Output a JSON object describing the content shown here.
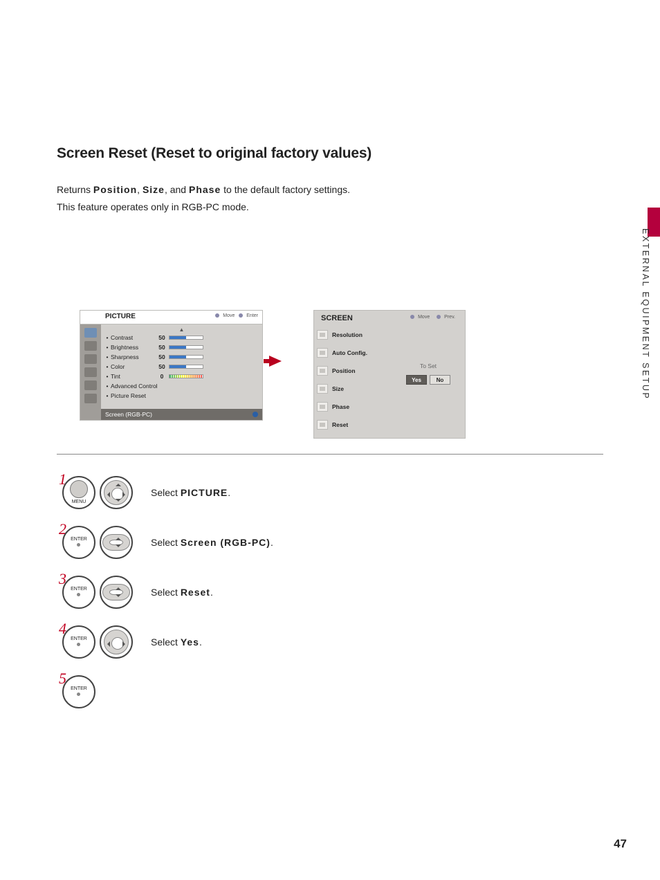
{
  "page": {
    "title": "Screen Reset (Reset to original factory values)",
    "intro_pre": "Returns ",
    "intro_w1": "Position",
    "intro_c1": ", ",
    "intro_w2": "Size",
    "intro_c2": ", and ",
    "intro_w3": "Phase",
    "intro_post": " to the default factory settings.",
    "intro_line2": "This feature operates only in RGB-PC mode.",
    "side_label": "EXTERNAL EQUIPMENT SETUP",
    "page_number": "47"
  },
  "osd_picture": {
    "title": "PICTURE",
    "hint_move": "Move",
    "hint_enter": "Enter",
    "rows": [
      {
        "label": "Contrast",
        "value": "50"
      },
      {
        "label": "Brightness",
        "value": "50"
      },
      {
        "label": "Sharpness",
        "value": "50"
      },
      {
        "label": "Color",
        "value": "50"
      },
      {
        "label": "Tint",
        "value": "0"
      }
    ],
    "link1": "Advanced Control",
    "link2": "Picture Reset",
    "selected": "Screen (RGB-PC)"
  },
  "osd_screen": {
    "title": "SCREEN",
    "hint_move": "Move",
    "hint_prev": "Prev.",
    "items": [
      "Resolution",
      "Auto Config.",
      "Position",
      "Size",
      "Phase",
      "Reset"
    ],
    "to_set": "To Set",
    "yes": "Yes",
    "no": "No"
  },
  "steps": {
    "s1_num": "1",
    "s1_btn": "MENU",
    "s1_pre": "Select ",
    "s1_bold": "PICTURE",
    "s1_post": ".",
    "s2_num": "2",
    "s2_btn": "ENTER",
    "s2_pre": "Select ",
    "s2_bold": "Screen (RGB-PC)",
    "s2_post": ".",
    "s3_num": "3",
    "s3_btn": "ENTER",
    "s3_pre": "Select ",
    "s3_bold": "Reset",
    "s3_post": ".",
    "s4_num": "4",
    "s4_btn": "ENTER",
    "s4_pre": "Select ",
    "s4_bold": "Yes",
    "s4_post": ".",
    "s5_num": "5",
    "s5_btn": "ENTER"
  }
}
